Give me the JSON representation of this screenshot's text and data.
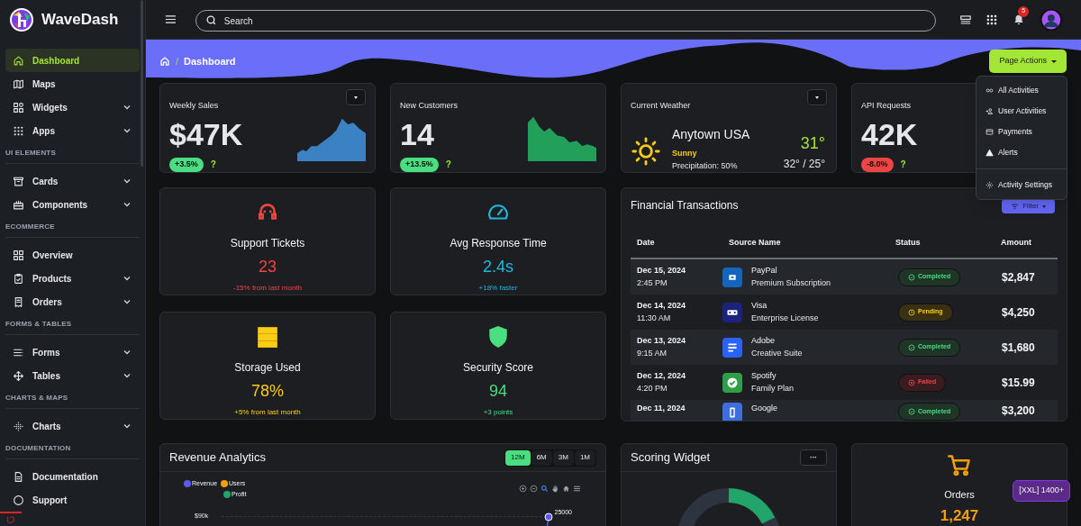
{
  "sidebar": {
    "brand": "WaveDash",
    "sections": [
      {
        "items": [
          {
            "label": "Dashboard",
            "selected": true,
            "expandable": false
          },
          {
            "label": "Maps",
            "selected": false,
            "expandable": false
          },
          {
            "label": "Widgets",
            "selected": false,
            "expandable": true
          },
          {
            "label": "Apps",
            "selected": false,
            "expandable": true
          }
        ]
      },
      {
        "heading": "UI ELEMENTS",
        "items": [
          {
            "label": "Cards",
            "selected": false,
            "expandable": true
          },
          {
            "label": "Components",
            "selected": false,
            "expandable": true
          }
        ]
      },
      {
        "heading": "ECOMMERCE",
        "items": [
          {
            "label": "Overview",
            "selected": false,
            "expandable": false
          },
          {
            "label": "Products",
            "selected": false,
            "expandable": true
          },
          {
            "label": "Orders",
            "selected": false,
            "expandable": true
          }
        ]
      },
      {
        "heading": "FORMS & TABLES",
        "items": [
          {
            "label": "Forms",
            "selected": false,
            "expandable": true
          },
          {
            "label": "Tables",
            "selected": false,
            "expandable": true
          }
        ]
      },
      {
        "heading": "CHARTS & MAPS",
        "items": [
          {
            "label": "Charts",
            "selected": false,
            "expandable": true
          }
        ]
      },
      {
        "heading": "DOCUMENTATION",
        "items": [
          {
            "label": "Documentation",
            "selected": false,
            "expandable": false
          },
          {
            "label": "Support",
            "selected": false,
            "expandable": false
          }
        ]
      }
    ]
  },
  "topbar": {
    "search": {
      "placeholder": "Search"
    },
    "notifications": "5"
  },
  "breadcrumb": {
    "separator": "/",
    "current": "Dashboard"
  },
  "page_actions": {
    "label": "Page Actions",
    "expanded": true,
    "menu": [
      {
        "label": "All Activities"
      },
      {
        "label": "User Activities"
      },
      {
        "label": "Payments"
      },
      {
        "label": "Alerts"
      },
      {
        "label": "Activity Settings",
        "separated": true
      }
    ]
  },
  "stats": [
    {
      "kind": "stat",
      "title": "Weekly Sales",
      "value": "$47K",
      "change": "+3.5%",
      "positive": true,
      "help": "?",
      "sparkline": true,
      "color": "#3b82c4",
      "menu": true
    },
    {
      "kind": "stat",
      "title": "New Customers",
      "value": "14",
      "change": "+13.5%",
      "positive": true,
      "help": "?",
      "sparkline": true,
      "color": "#22a05a",
      "menu": false
    },
    {
      "kind": "weather",
      "title": "Current Weather",
      "city": "Anytown USA",
      "condition": "Sunny",
      "precipitation": "Precipitation: 50%",
      "temp": "31°",
      "range": "32° / 25°",
      "menu": true
    },
    {
      "kind": "stat",
      "title": "API Requests",
      "value": "42K",
      "change": "-8.0%",
      "positive": false,
      "help": "?",
      "menu": false
    }
  ],
  "metrics": [
    {
      "title": "Support Tickets",
      "value": "23",
      "note": "-15% from last month",
      "color": "#ef4444"
    },
    {
      "title": "Avg Response Time",
      "value": "2.4s",
      "note": "+18% faster",
      "color": "#22b8e0"
    },
    {
      "title": "Storage Used",
      "value": "78%",
      "note": "+5% from last month",
      "color": "#facc15"
    },
    {
      "title": "Security Score",
      "value": "94",
      "note": "+3 points",
      "color": "#4ade80"
    }
  ],
  "transactions": {
    "title": "Financial Transactions",
    "filter": "Filter",
    "columns": [
      "Date",
      "Source Name",
      "Status",
      "Amount"
    ],
    "rows": [
      {
        "date": "Dec 15, 2024",
        "time": "2:45 PM",
        "source": "PayPal",
        "detail": "Premium Subscription",
        "color": "#1565c0",
        "status": "Completed",
        "kind": "completed",
        "amount": "$2,847"
      },
      {
        "date": "Dec 14, 2024",
        "time": "11:30 AM",
        "source": "Visa",
        "detail": "Enterprise License",
        "color": "#1a237e",
        "status": "Pending",
        "kind": "pending",
        "amount": "$4,250"
      },
      {
        "date": "Dec 13, 2024",
        "time": "9:15 AM",
        "source": "Adobe",
        "detail": "Creative Suite",
        "color": "#2962ff",
        "status": "Completed",
        "kind": "completed",
        "amount": "$1,680"
      },
      {
        "date": "Dec 12, 2024",
        "time": "4:20 PM",
        "source": "Spotify",
        "detail": "Family Plan",
        "color": "#2ea043",
        "status": "Failed",
        "kind": "failed",
        "amount": "$15.99"
      },
      {
        "date": "Dec 11, 2024",
        "source": "Google",
        "color": "#3b6fe0",
        "status": "Completed",
        "kind": "completed",
        "amount": "$3,200"
      }
    ]
  },
  "revenue": {
    "title": "Revenue Analytics",
    "ranges": [
      {
        "label": "12M",
        "selected": true
      },
      {
        "label": "6M",
        "selected": false
      },
      {
        "label": "3M",
        "selected": false
      },
      {
        "label": "1M",
        "selected": false
      }
    ],
    "legend": [
      {
        "label": "Revenue",
        "color": "#5b5bf0"
      },
      {
        "label": "Users",
        "color": "#f59e0b"
      },
      {
        "label": "Profit",
        "color": "#22a56b"
      }
    ],
    "y_tick": "$90k",
    "point_label": "25000"
  },
  "scoring": {
    "title": "Scoring Widget",
    "menu": "···"
  },
  "orders": {
    "title": "Orders",
    "value": "1,247"
  },
  "breakpoint_badge": "[XXL] 1400+"
}
